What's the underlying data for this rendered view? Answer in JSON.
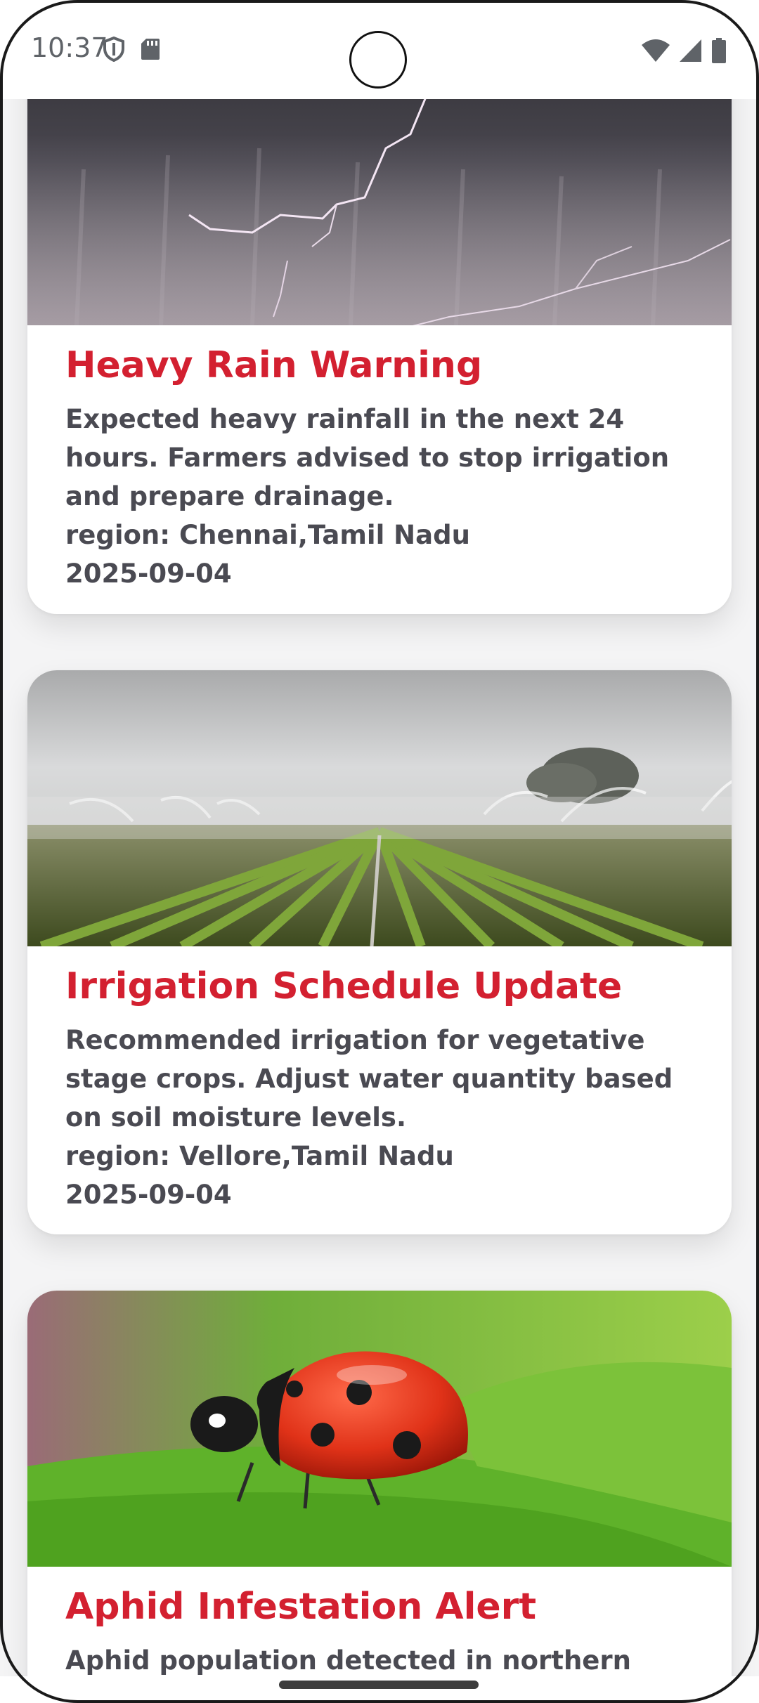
{
  "status_bar": {
    "time": "10:37",
    "left_icons": [
      "shield-icon",
      "sd-card-icon"
    ],
    "right_icons": [
      "wifi-icon",
      "signal-icon",
      "battery-icon"
    ]
  },
  "alerts": [
    {
      "title": "Heavy Rain Warning",
      "description": "Expected heavy rainfall in the next 24 hours. Farmers advised to stop irrigation and prepare drainage.",
      "region": "region: Chennai,Tamil Nadu",
      "date": "2025-09-04",
      "image": "storm-lightning-photo"
    },
    {
      "title": "Irrigation Schedule Update",
      "description": "Recommended irrigation for vegetative stage crops. Adjust water quantity based on soil moisture levels.",
      "region": "region: Vellore,Tamil Nadu",
      "date": "2025-09-04",
      "image": "sprinkler-field-photo"
    },
    {
      "title": "Aphid Infestation Alert",
      "description": "Aphid population detected in northern fields.",
      "image": "ladybug-leaf-photo"
    }
  ],
  "colors": {
    "title_red": "#d32030",
    "body_text": "#4a4a52",
    "background": "#f4f4f5"
  }
}
